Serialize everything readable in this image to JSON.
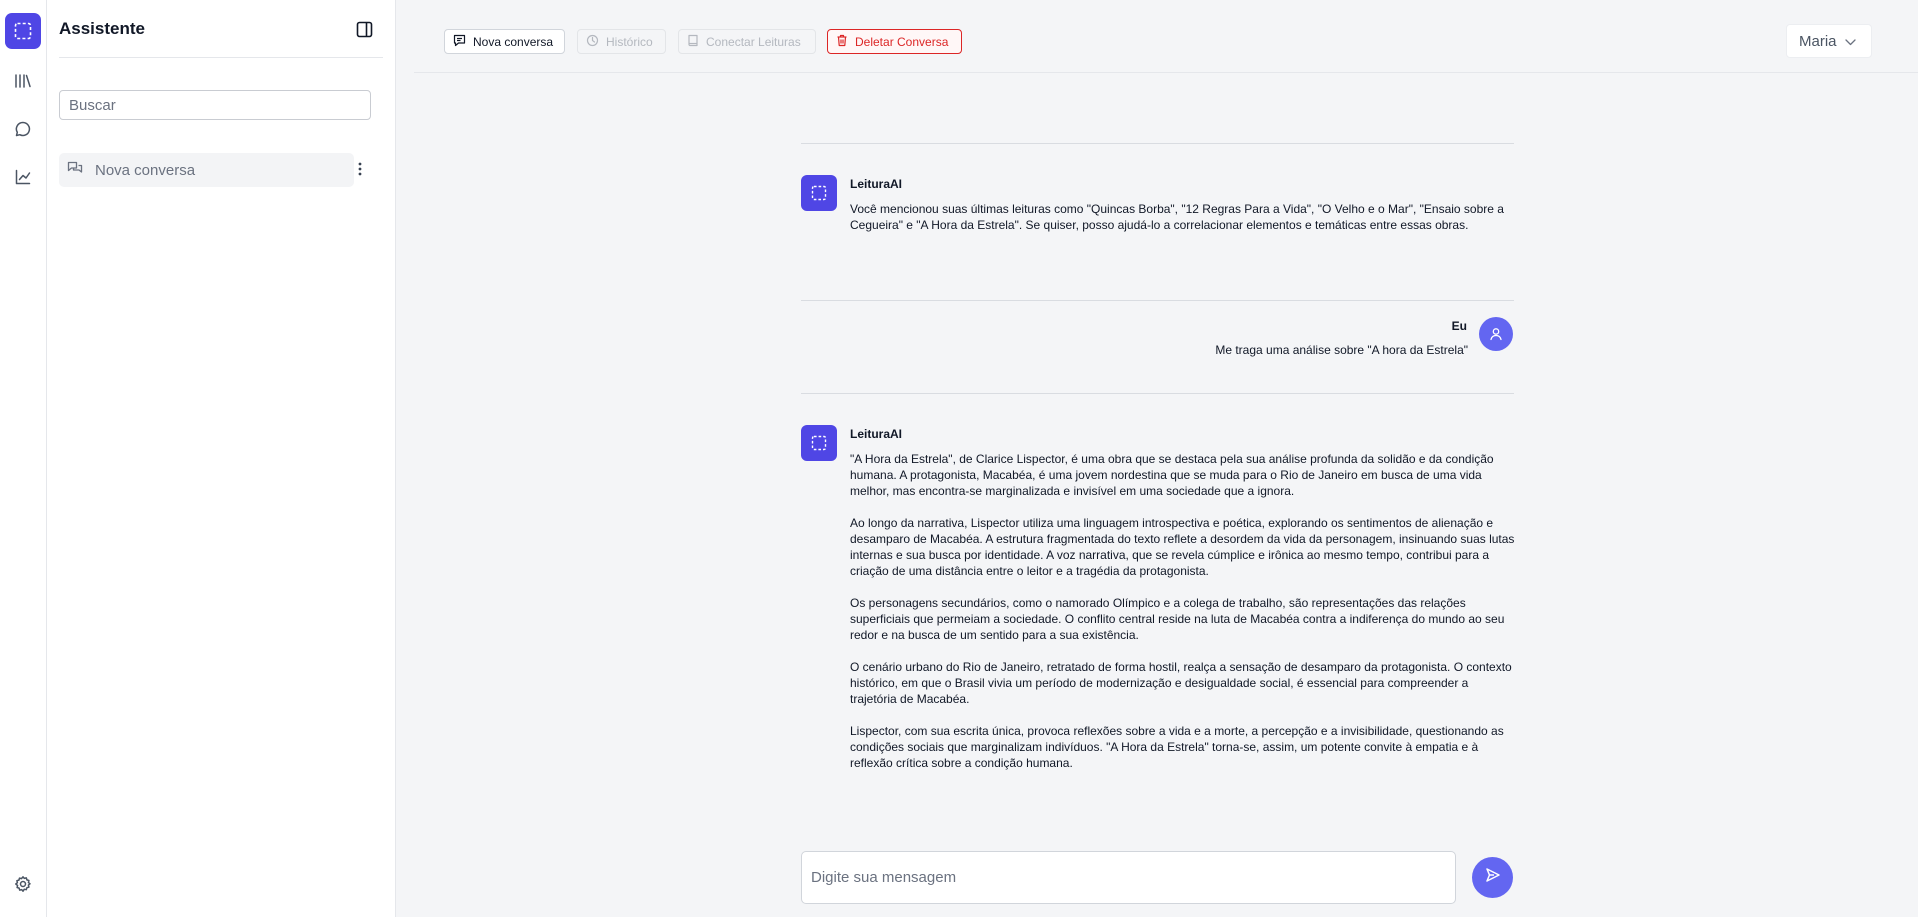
{
  "colors": {
    "accent": "#4f46e5",
    "accent_light": "#6366f1",
    "danger": "#dc2626",
    "background": "#f4f5f7"
  },
  "rail": {
    "icons": [
      "app-logo-icon",
      "library-icon",
      "chat-icon",
      "chart-icon",
      "settings-icon"
    ]
  },
  "sidebar": {
    "title": "Assistente",
    "search_placeholder": "Buscar",
    "conversations": [
      {
        "label": "Nova conversa",
        "icon": "chat-bubbles-icon"
      }
    ]
  },
  "toolbar": {
    "new_chat": "Nova conversa",
    "history": "Histórico",
    "connect": "Conectar Leituras",
    "delete": "Deletar Conversa"
  },
  "user_menu": {
    "selected": "Maria"
  },
  "messages": [
    {
      "sender": "LeituraAI",
      "role": "assistant",
      "paragraphs": [
        "Você mencionou suas últimas leituras como \"Quincas Borba\", \"12 Regras Para a Vida\", \"O Velho e o Mar\", \"Ensaio sobre a Cegueira\" e \"A Hora da Estrela\". Se quiser, posso ajudá-lo a correlacionar elementos e temáticas entre essas obras."
      ]
    },
    {
      "sender": "Eu",
      "role": "user",
      "paragraphs": [
        "Me traga uma análise sobre \"A hora da Estrela\""
      ]
    },
    {
      "sender": "LeituraAI",
      "role": "assistant",
      "paragraphs": [
        "\"A Hora da Estrela\", de Clarice Lispector, é uma obra que se destaca pela sua análise profunda da solidão e da condição humana. A protagonista, Macabéa, é uma jovem nordestina que se muda para o Rio de Janeiro em busca de uma vida melhor, mas encontra-se marginalizada e invisível em uma sociedade que a ignora.",
        "Ao longo da narrativa, Lispector utiliza uma linguagem introspectiva e poética, explorando os sentimentos de alienação e desamparo de Macabéa. A estrutura fragmentada do texto reflete a desordem da vida da personagem, insinuando suas lutas internas e sua busca por identidade. A voz narrativa, que se revela cúmplice e irônica ao mesmo tempo, contribui para a criação de uma distância entre o leitor e a tragédia da protagonista.",
        "Os personagens secundários, como o namorado Olímpico e a colega de trabalho, são representações das relações superficiais que permeiam a sociedade. O conflito central reside na luta de Macabéa contra a indiferença do mundo ao seu redor e na busca de um sentido para a sua existência.",
        "O cenário urbano do Rio de Janeiro, retratado de forma hostil, realça a sensação de desamparo da protagonista. O contexto histórico, em que o Brasil vivia um período de modernização e desigualdade social, é essencial para compreender a trajetória de Macabéa.",
        "Lispector, com sua escrita única, provoca reflexões sobre a vida e a morte, a percepção e a invisibilidade, questionando as condições sociais que marginalizam indivíduos. \"A Hora da Estrela\" torna-se, assim, um potente convite à empatia e à reflexão crítica sobre a condição humana."
      ]
    }
  ],
  "composer": {
    "placeholder": "Digite sua mensagem"
  }
}
